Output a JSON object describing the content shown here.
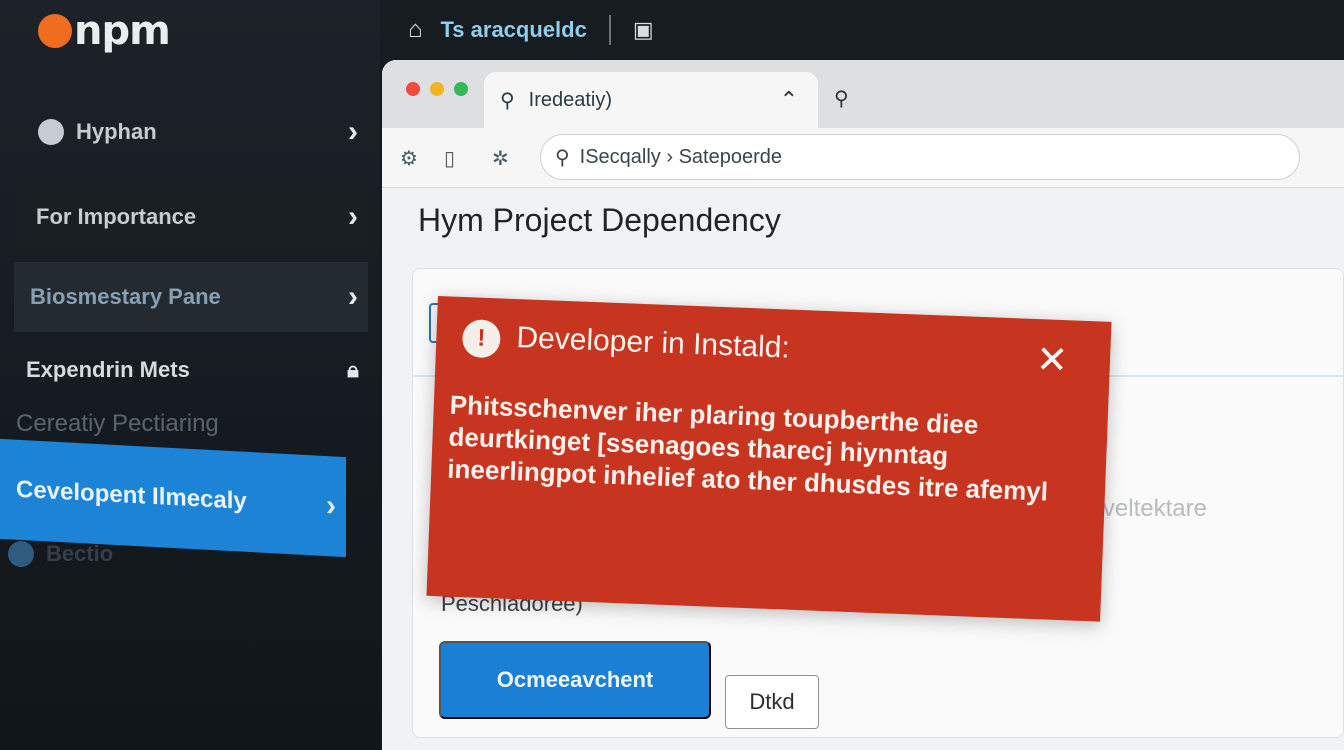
{
  "sidebar": {
    "logo": "npm",
    "items": [
      {
        "label": "Hyphan",
        "chevron": "›"
      },
      {
        "label": "For Importance",
        "chevron": "›"
      },
      {
        "label": "Biosmestary Pane",
        "chevron": "›"
      },
      {
        "label": "Expendrin Mets"
      },
      {
        "label": "Cereatiy Pectiaring"
      },
      {
        "label": "Cevelopent Ilmecaly",
        "chevron": "›"
      },
      {
        "label": "Bectio"
      }
    ]
  },
  "topbar": {
    "breadcrumb": "Ts aracqueldc"
  },
  "browser": {
    "tab": {
      "title": "Iredeatiy)"
    },
    "url": "ISecqally › Satepoerde",
    "page_title": "Hym Project Dependency"
  },
  "card": {
    "ghost_row": "Flosdnd » shsdsenarp Prequngs Crafate Teserr(Canr Peneids   veltektare",
    "description": "Dnecsartaioe otlatide Baafy alear Peschiadoree)",
    "primary_button": "Ocmeeavchent",
    "secondary_button": "Dtkd"
  },
  "alert": {
    "title": "Developer in Instald:",
    "close": "✕",
    "body": "Phitsschenver iher plaring toupberthe diee deurtkinget [ssenagoes tharecj hiynntag ineerlingpot inhelief ato ther dhusdes itre afemyl",
    "color": "#c73521"
  }
}
